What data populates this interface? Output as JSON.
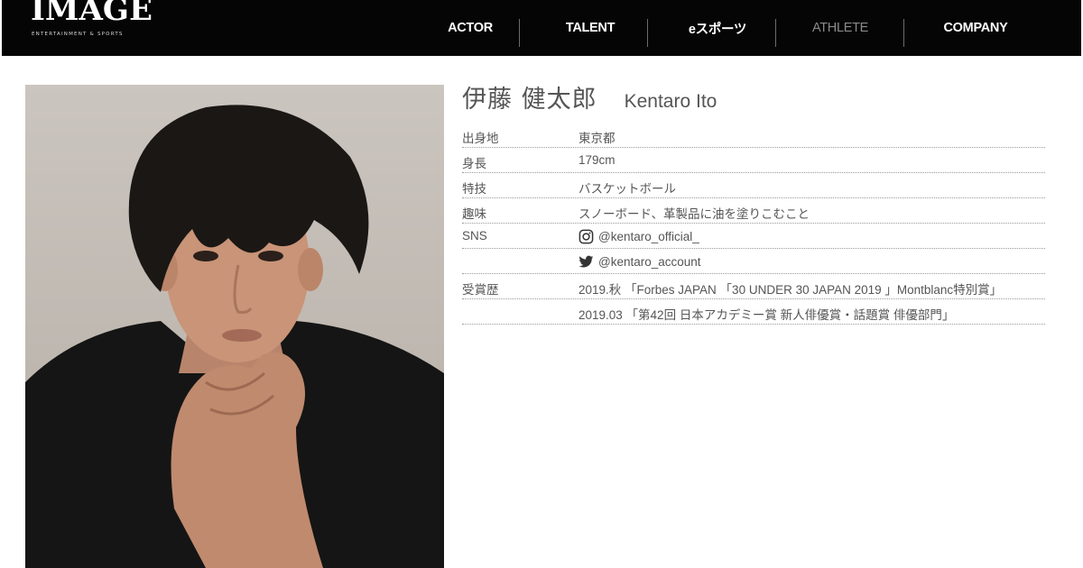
{
  "header": {
    "logo": {
      "main": "IMAGE",
      "sub": "ENTERTAINMENT & SPORTS"
    },
    "nav": [
      {
        "label": "ACTOR",
        "active": true
      },
      {
        "label": "TALENT",
        "active": true
      },
      {
        "label": "eスポーツ",
        "active": true
      },
      {
        "label": "ATHLETE",
        "active": false
      },
      {
        "label": "COMPANY",
        "active": true
      }
    ]
  },
  "profile": {
    "name_jp": "伊藤 健太郎",
    "name_en": "Kentaro Ito",
    "rows": [
      {
        "label": "出身地",
        "value": "東京都"
      },
      {
        "label": "身長",
        "value": "179cm"
      },
      {
        "label": "特技",
        "value": "バスケットボール"
      },
      {
        "label": "趣味",
        "value": "スノーボード、革製品に油を塗りこむこと"
      },
      {
        "label": "SNS",
        "value": "@kentaro_official_",
        "icon": "instagram-icon"
      },
      {
        "label": "",
        "value": "@kentaro_account",
        "icon": "twitter-icon"
      },
      {
        "label": "受賞歴",
        "value": "2019.秋 「Forbes JAPAN 「30 UNDER 30 JAPAN 2019 」Montblanc特別賞」"
      },
      {
        "label": "",
        "value": "2019.03 「第42回 日本アカデミー賞 新人俳優賞・話題賞 俳優部門」"
      }
    ]
  },
  "colors": {
    "header_bg": "#050505",
    "nav_text": "#ffffff",
    "nav_dim": "#8a8a8a",
    "body_text": "#555555"
  }
}
